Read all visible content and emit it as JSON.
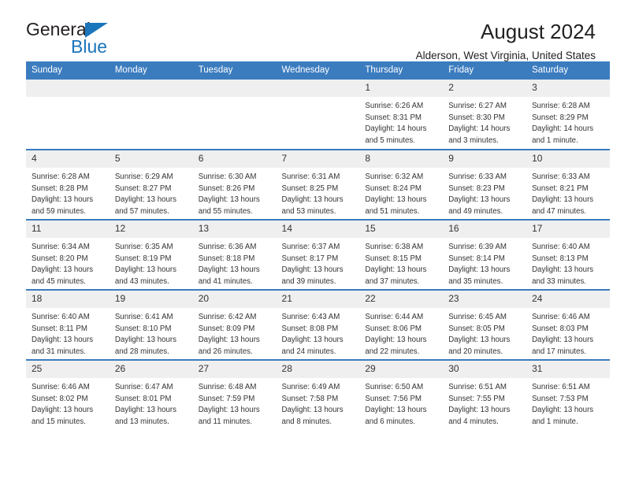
{
  "brand": {
    "name_part1": "General",
    "name_part2": "Blue",
    "accent_color": "#1b75bb"
  },
  "header": {
    "title": "August 2024",
    "subtitle": "Alderson, West Virginia, United States"
  },
  "theme": {
    "header_row_color": "#3b7cbf",
    "daynum_strip_color": "#efefef",
    "text_color": "#333333"
  },
  "weekday_headers": [
    "Sunday",
    "Monday",
    "Tuesday",
    "Wednesday",
    "Thursday",
    "Friday",
    "Saturday"
  ],
  "labels": {
    "sunrise": "Sunrise:",
    "sunset": "Sunset:",
    "daylight": "Daylight:"
  },
  "weeks": [
    [
      {
        "day": "",
        "empty": true
      },
      {
        "day": "",
        "empty": true
      },
      {
        "day": "",
        "empty": true
      },
      {
        "day": "",
        "empty": true
      },
      {
        "day": "1",
        "sunrise": "Sunrise: 6:26 AM",
        "sunset": "Sunset: 8:31 PM",
        "daylight1": "Daylight: 14 hours",
        "daylight2": "and 5 minutes."
      },
      {
        "day": "2",
        "sunrise": "Sunrise: 6:27 AM",
        "sunset": "Sunset: 8:30 PM",
        "daylight1": "Daylight: 14 hours",
        "daylight2": "and 3 minutes."
      },
      {
        "day": "3",
        "sunrise": "Sunrise: 6:28 AM",
        "sunset": "Sunset: 8:29 PM",
        "daylight1": "Daylight: 14 hours",
        "daylight2": "and 1 minute."
      }
    ],
    [
      {
        "day": "4",
        "sunrise": "Sunrise: 6:28 AM",
        "sunset": "Sunset: 8:28 PM",
        "daylight1": "Daylight: 13 hours",
        "daylight2": "and 59 minutes."
      },
      {
        "day": "5",
        "sunrise": "Sunrise: 6:29 AM",
        "sunset": "Sunset: 8:27 PM",
        "daylight1": "Daylight: 13 hours",
        "daylight2": "and 57 minutes."
      },
      {
        "day": "6",
        "sunrise": "Sunrise: 6:30 AM",
        "sunset": "Sunset: 8:26 PM",
        "daylight1": "Daylight: 13 hours",
        "daylight2": "and 55 minutes."
      },
      {
        "day": "7",
        "sunrise": "Sunrise: 6:31 AM",
        "sunset": "Sunset: 8:25 PM",
        "daylight1": "Daylight: 13 hours",
        "daylight2": "and 53 minutes."
      },
      {
        "day": "8",
        "sunrise": "Sunrise: 6:32 AM",
        "sunset": "Sunset: 8:24 PM",
        "daylight1": "Daylight: 13 hours",
        "daylight2": "and 51 minutes."
      },
      {
        "day": "9",
        "sunrise": "Sunrise: 6:33 AM",
        "sunset": "Sunset: 8:23 PM",
        "daylight1": "Daylight: 13 hours",
        "daylight2": "and 49 minutes."
      },
      {
        "day": "10",
        "sunrise": "Sunrise: 6:33 AM",
        "sunset": "Sunset: 8:21 PM",
        "daylight1": "Daylight: 13 hours",
        "daylight2": "and 47 minutes."
      }
    ],
    [
      {
        "day": "11",
        "sunrise": "Sunrise: 6:34 AM",
        "sunset": "Sunset: 8:20 PM",
        "daylight1": "Daylight: 13 hours",
        "daylight2": "and 45 minutes."
      },
      {
        "day": "12",
        "sunrise": "Sunrise: 6:35 AM",
        "sunset": "Sunset: 8:19 PM",
        "daylight1": "Daylight: 13 hours",
        "daylight2": "and 43 minutes."
      },
      {
        "day": "13",
        "sunrise": "Sunrise: 6:36 AM",
        "sunset": "Sunset: 8:18 PM",
        "daylight1": "Daylight: 13 hours",
        "daylight2": "and 41 minutes."
      },
      {
        "day": "14",
        "sunrise": "Sunrise: 6:37 AM",
        "sunset": "Sunset: 8:17 PM",
        "daylight1": "Daylight: 13 hours",
        "daylight2": "and 39 minutes."
      },
      {
        "day": "15",
        "sunrise": "Sunrise: 6:38 AM",
        "sunset": "Sunset: 8:15 PM",
        "daylight1": "Daylight: 13 hours",
        "daylight2": "and 37 minutes."
      },
      {
        "day": "16",
        "sunrise": "Sunrise: 6:39 AM",
        "sunset": "Sunset: 8:14 PM",
        "daylight1": "Daylight: 13 hours",
        "daylight2": "and 35 minutes."
      },
      {
        "day": "17",
        "sunrise": "Sunrise: 6:40 AM",
        "sunset": "Sunset: 8:13 PM",
        "daylight1": "Daylight: 13 hours",
        "daylight2": "and 33 minutes."
      }
    ],
    [
      {
        "day": "18",
        "sunrise": "Sunrise: 6:40 AM",
        "sunset": "Sunset: 8:11 PM",
        "daylight1": "Daylight: 13 hours",
        "daylight2": "and 31 minutes."
      },
      {
        "day": "19",
        "sunrise": "Sunrise: 6:41 AM",
        "sunset": "Sunset: 8:10 PM",
        "daylight1": "Daylight: 13 hours",
        "daylight2": "and 28 minutes."
      },
      {
        "day": "20",
        "sunrise": "Sunrise: 6:42 AM",
        "sunset": "Sunset: 8:09 PM",
        "daylight1": "Daylight: 13 hours",
        "daylight2": "and 26 minutes."
      },
      {
        "day": "21",
        "sunrise": "Sunrise: 6:43 AM",
        "sunset": "Sunset: 8:08 PM",
        "daylight1": "Daylight: 13 hours",
        "daylight2": "and 24 minutes."
      },
      {
        "day": "22",
        "sunrise": "Sunrise: 6:44 AM",
        "sunset": "Sunset: 8:06 PM",
        "daylight1": "Daylight: 13 hours",
        "daylight2": "and 22 minutes."
      },
      {
        "day": "23",
        "sunrise": "Sunrise: 6:45 AM",
        "sunset": "Sunset: 8:05 PM",
        "daylight1": "Daylight: 13 hours",
        "daylight2": "and 20 minutes."
      },
      {
        "day": "24",
        "sunrise": "Sunrise: 6:46 AM",
        "sunset": "Sunset: 8:03 PM",
        "daylight1": "Daylight: 13 hours",
        "daylight2": "and 17 minutes."
      }
    ],
    [
      {
        "day": "25",
        "sunrise": "Sunrise: 6:46 AM",
        "sunset": "Sunset: 8:02 PM",
        "daylight1": "Daylight: 13 hours",
        "daylight2": "and 15 minutes."
      },
      {
        "day": "26",
        "sunrise": "Sunrise: 6:47 AM",
        "sunset": "Sunset: 8:01 PM",
        "daylight1": "Daylight: 13 hours",
        "daylight2": "and 13 minutes."
      },
      {
        "day": "27",
        "sunrise": "Sunrise: 6:48 AM",
        "sunset": "Sunset: 7:59 PM",
        "daylight1": "Daylight: 13 hours",
        "daylight2": "and 11 minutes."
      },
      {
        "day": "28",
        "sunrise": "Sunrise: 6:49 AM",
        "sunset": "Sunset: 7:58 PM",
        "daylight1": "Daylight: 13 hours",
        "daylight2": "and 8 minutes."
      },
      {
        "day": "29",
        "sunrise": "Sunrise: 6:50 AM",
        "sunset": "Sunset: 7:56 PM",
        "daylight1": "Daylight: 13 hours",
        "daylight2": "and 6 minutes."
      },
      {
        "day": "30",
        "sunrise": "Sunrise: 6:51 AM",
        "sunset": "Sunset: 7:55 PM",
        "daylight1": "Daylight: 13 hours",
        "daylight2": "and 4 minutes."
      },
      {
        "day": "31",
        "sunrise": "Sunrise: 6:51 AM",
        "sunset": "Sunset: 7:53 PM",
        "daylight1": "Daylight: 13 hours",
        "daylight2": "and 1 minute."
      }
    ]
  ]
}
